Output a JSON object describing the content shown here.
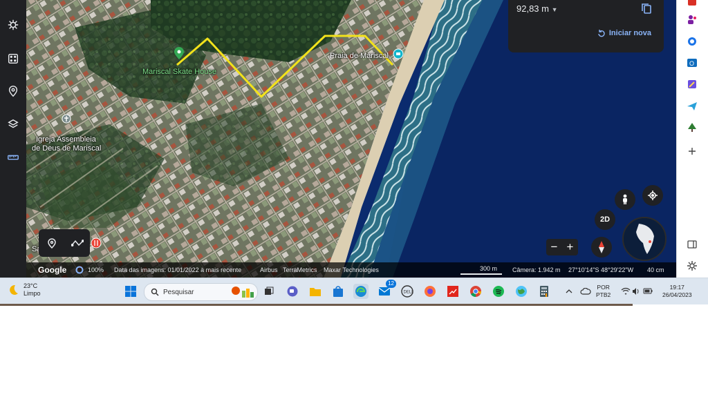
{
  "map": {
    "labels": {
      "skate_house": "Mariscal Skate House",
      "beach": "Praia de Mariscal",
      "church_line1": "Igreja Assembleia",
      "church_line2": "de Deus de Mariscal",
      "partial_left": "Sa"
    },
    "path_color": "#f2e21b"
  },
  "measure": {
    "distance": "92,83 m",
    "restart_label": "Iniciar nova"
  },
  "controls": {
    "mode_2d": "2D",
    "zoom_out": "−",
    "zoom_in": "+"
  },
  "attribution": {
    "google": "Google",
    "percent": "100%",
    "date": "Data das imagens: 01/01/2022 à mais recente",
    "airbus": "Airbus",
    "terrametrics": "TerraMetrics",
    "maxar": "Maxar Technologies",
    "scale": "300 m",
    "camera": "Câmera: 1.942 m",
    "coords": "27°10'14\"S 48°29'22\"W",
    "cm": "40 cm"
  },
  "taskbar": {
    "temp": "23°C",
    "condition": "Limpo",
    "search_placeholder": "Pesquisar",
    "mail_badge": "12",
    "lang_line1": "POR",
    "lang_line2": "PTB2",
    "time": "19:17",
    "date": "26/04/2023"
  },
  "colors": {
    "dark_panel": "#202124",
    "accent_blue": "#8ab4f8",
    "ocean": "#0b2b6e"
  }
}
